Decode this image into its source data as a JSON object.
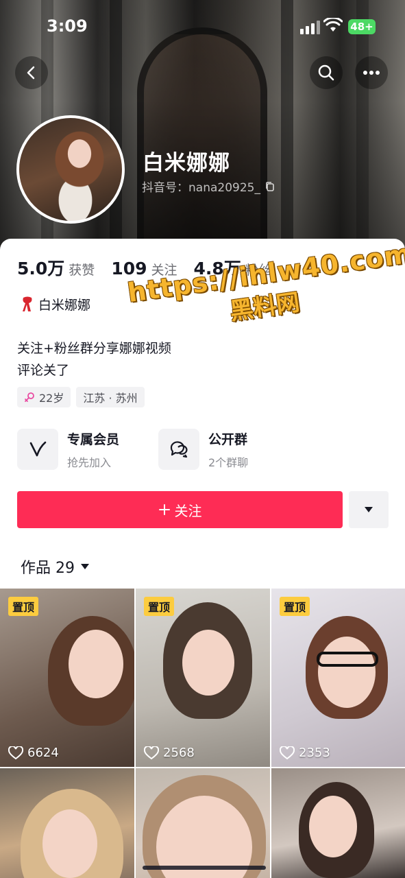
{
  "status_bar": {
    "time": "3:09",
    "battery": "48+"
  },
  "profile": {
    "name": "白米娜娜",
    "douyin_id": "抖音号：nana20925_",
    "stats": [
      {
        "num": "5.0万",
        "label": "获赞"
      },
      {
        "num": "109",
        "label": "关注"
      },
      {
        "num": "4.8万",
        "label": "粉丝"
      }
    ],
    "tag_name": "白米娜娜",
    "bio_line1": "关注+粉丝群分享娜娜视频",
    "bio_line2": "评论关了",
    "chips": {
      "age": "22岁",
      "location": "江苏 · 苏州"
    }
  },
  "watermark": {
    "url": "https://ihlw40.com",
    "subtitle": "黑料网"
  },
  "features": [
    {
      "title": "专属会员",
      "subtitle": "抢先加入",
      "icon": "v-icon"
    },
    {
      "title": "公开群",
      "subtitle": "2个群聊",
      "icon": "chat-icon"
    }
  ],
  "actions": {
    "follow_label": "关注"
  },
  "works": {
    "tab_label": "作品 29",
    "pin_label": "置顶",
    "tiles": [
      {
        "likes": "6624",
        "pinned": true
      },
      {
        "likes": "2568",
        "pinned": true
      },
      {
        "likes": "2353",
        "pinned": true
      },
      {
        "likes": "",
        "pinned": false
      },
      {
        "likes": "",
        "pinned": false
      },
      {
        "likes": "",
        "pinned": false
      }
    ]
  },
  "colors": {
    "accent": "#fe2c55",
    "pin_badge": "#fccc3f",
    "battery": "#4cd964",
    "watermark": "#f6b52e"
  }
}
